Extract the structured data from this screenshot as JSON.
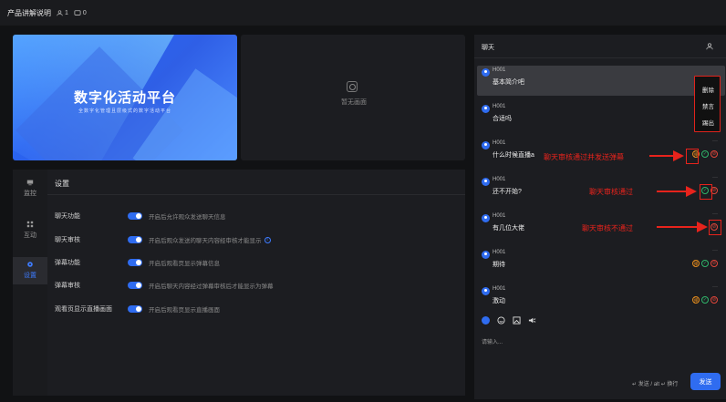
{
  "topbar": {
    "title": "产品讲解说明",
    "viewers": "1",
    "comments": "0"
  },
  "preview": {
    "title": "数字化活动平台",
    "subtitle": "全数字化管理且层级式的数字活动平台"
  },
  "empty_screen": {
    "label": "暂无画面"
  },
  "sidebar": {
    "items": [
      {
        "label": "监控",
        "icon": "monitor-icon"
      },
      {
        "label": "互动",
        "icon": "grid-icon"
      },
      {
        "label": "设置",
        "icon": "gear-icon",
        "active": true
      }
    ]
  },
  "settings": {
    "title": "设置",
    "rows": [
      {
        "label": "聊天功能",
        "desc": "开启后允许观众发送聊天信息",
        "on": true
      },
      {
        "label": "聊天审核",
        "desc": "开启后观众发送的聊天内容经审核才能显示",
        "on": true,
        "info": true
      },
      {
        "label": "弹幕功能",
        "desc": "开启后观看页显示弹幕信息",
        "on": true
      },
      {
        "label": "弹幕审核",
        "desc": "开启后聊天内容经过弹幕审核后才能显示为弹幕",
        "on": true
      },
      {
        "label": "观看页显示直播画面",
        "desc": "开启后观看页显示直播画面",
        "on": true
      }
    ]
  },
  "chat": {
    "title": "聊天",
    "messages": [
      {
        "user": "H001",
        "text": "基本简介吧"
      },
      {
        "user": "H001",
        "text": "合适吗"
      },
      {
        "user": "H001",
        "text": "什么时候直播a"
      },
      {
        "user": "H001",
        "text": "还不开始?"
      },
      {
        "user": "H001",
        "text": "有几位大佬"
      },
      {
        "user": "H001",
        "text": "期待"
      },
      {
        "user": "H001",
        "text": "激动"
      }
    ],
    "menu": [
      "删除",
      "禁言",
      "踢出"
    ],
    "input_placeholder": "请输入...",
    "hint": "↵ 发送 / alt ↵ 换行",
    "send": "发送"
  },
  "annotations": {
    "a1": "聊天审核通过并发送弹幕",
    "a2": "聊天审核通过",
    "a3": "聊天审核不通过"
  },
  "colors": {
    "accent": "#2f6cf0",
    "annotation": "#e8231c"
  }
}
